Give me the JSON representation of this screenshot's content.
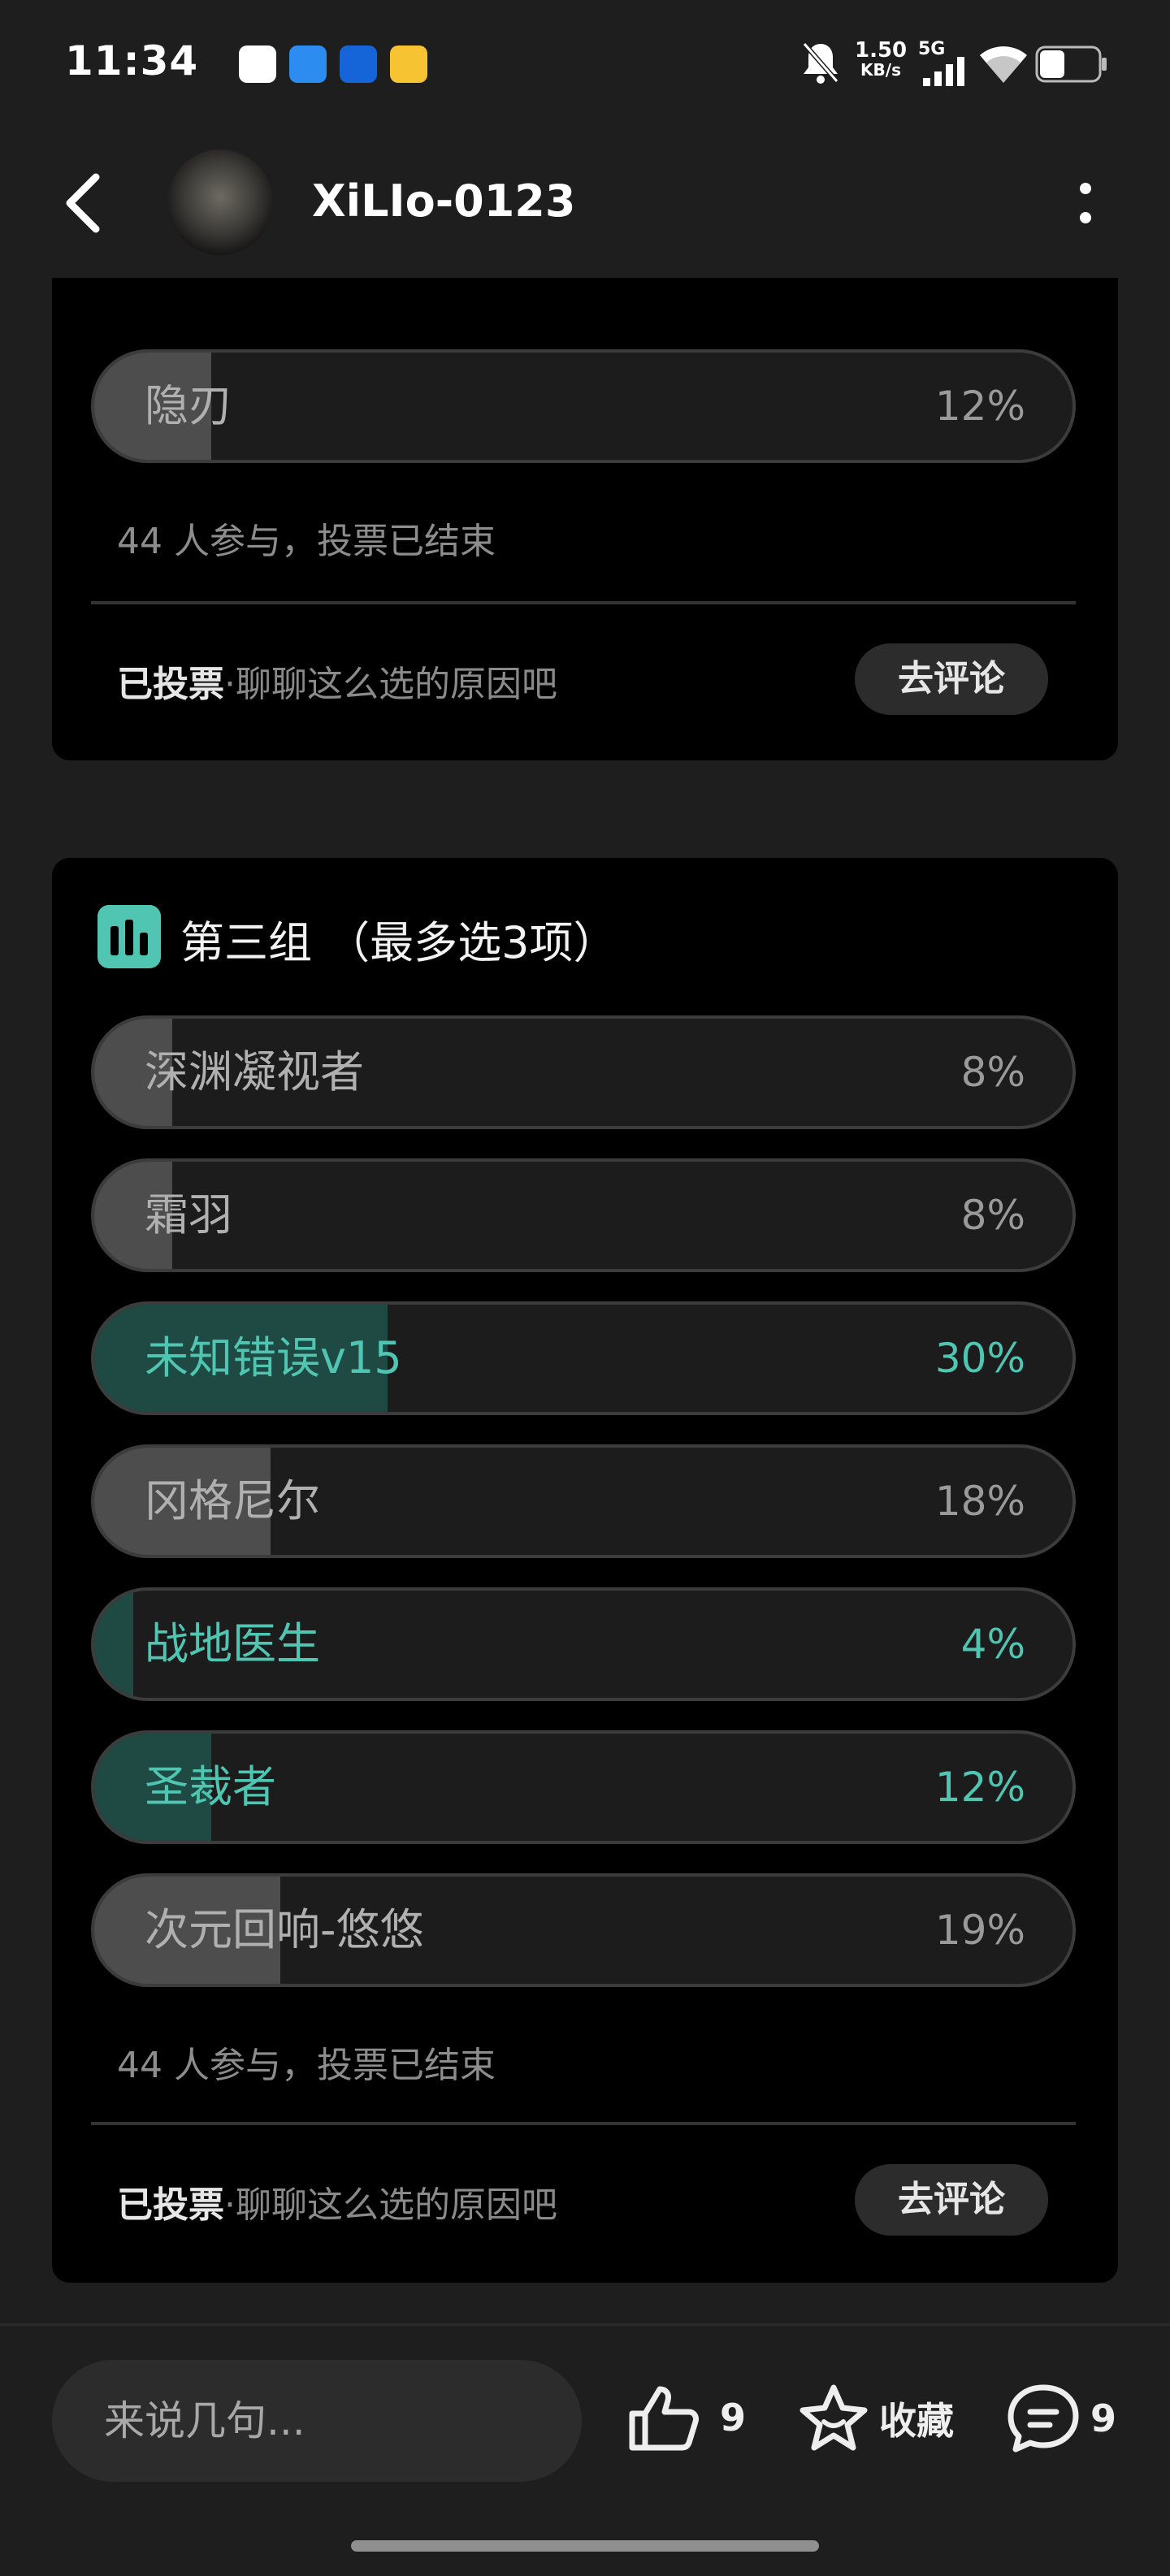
{
  "status_bar": {
    "time": "11:34",
    "net_speed_value": "1.50",
    "net_speed_unit": "KB/s",
    "network_type": "5G",
    "app_icon_colors": [
      "#ffffff",
      "#2d8cf0",
      "#1565d8",
      "#f6c332"
    ]
  },
  "header": {
    "username": "XiLIo-0123"
  },
  "poll_top": {
    "options": [
      {
        "label": "隐刃",
        "percent": "12%",
        "fill": 0.12,
        "selected": false
      }
    ],
    "participants": "44 人参与，投票已结束",
    "voted_label": "已投票",
    "voted_prompt": "·聊聊这么选的原因吧",
    "comment_button": "去评论"
  },
  "poll_group3": {
    "title": "第三组 （最多选3项）",
    "options": [
      {
        "label": "深渊凝视者",
        "percent": "8%",
        "fill": 0.08,
        "selected": false
      },
      {
        "label": "霜羽",
        "percent": "8%",
        "fill": 0.08,
        "selected": false
      },
      {
        "label": "未知错误v15",
        "percent": "30%",
        "fill": 0.3,
        "selected": true
      },
      {
        "label": "冈格尼尔",
        "percent": "18%",
        "fill": 0.18,
        "selected": false
      },
      {
        "label": "战地医生",
        "percent": "4%",
        "fill": 0.04,
        "selected": true
      },
      {
        "label": "圣裁者",
        "percent": "12%",
        "fill": 0.12,
        "selected": true
      },
      {
        "label": "次元回响-悠悠",
        "percent": "19%",
        "fill": 0.19,
        "selected": false
      }
    ],
    "participants": "44 人参与，投票已结束",
    "voted_label": "已投票",
    "voted_prompt": "·聊聊这么选的原因吧",
    "comment_button": "去评论"
  },
  "bottom_bar": {
    "comment_placeholder": "来说几句...",
    "like_count": "9",
    "favorite_label": "收藏",
    "comment_count": "9"
  },
  "colors": {
    "accent": "#4fc5b2",
    "selected_fill": "#1f4a44",
    "bar_fill": "#4d4d4d",
    "card_bg": "#000000",
    "page_bg": "#1e1e1e"
  }
}
